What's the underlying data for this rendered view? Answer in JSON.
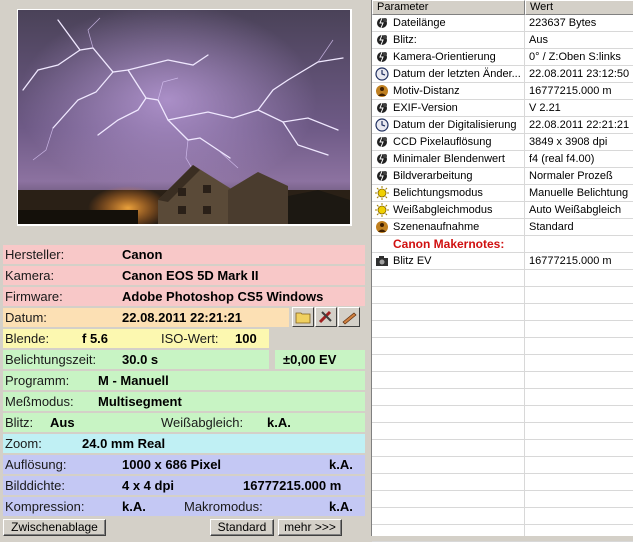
{
  "camera": {
    "hersteller_label": "Hersteller:",
    "hersteller": "Canon",
    "kamera_label": "Kamera:",
    "kamera": "Canon EOS 5D Mark II",
    "firmware_label": "Firmware:",
    "firmware": "Adobe Photoshop CS5 Windows",
    "datum_label": "Datum:",
    "datum": "22.08.2011 22:21:21",
    "blende_label": "Blende:",
    "blende": "f 5.6",
    "iso_label": "ISO-Wert:",
    "iso": "100",
    "belichtungszeit_label": "Belichtungszeit:",
    "belichtungszeit": "30.0 s",
    "ev": "±0,00 EV",
    "programm_label": "Programm:",
    "programm": "M - Manuell",
    "messmodus_label": "Meßmodus:",
    "messmodus": "Multisegment",
    "blitz_label": "Blitz:",
    "blitz": "Aus",
    "weiss_label": "Weißabgleich:",
    "weiss": "k.A.",
    "zoom_label": "Zoom:",
    "zoom": "24.0 mm Real",
    "aufloesung_label": "Auflösung:",
    "aufloesung": "1000 x 686 Pixel",
    "aufloesung_extra": "k.A.",
    "bilddichte_label": "Bilddichte:",
    "bilddichte": "4 x 4 dpi",
    "bilddichte_extra": "16777215.000 m",
    "kompression_label": "Kompression:",
    "kompression": "k.A.",
    "makro_label": "Makromodus:",
    "makro": "k.A."
  },
  "buttons": {
    "zwischenablage": "Zwischenablage",
    "standard": "Standard",
    "mehr": "mehr >>>"
  },
  "table": {
    "col_param": "Parameter",
    "col_wert": "Wert",
    "rows": [
      {
        "icon": "flash-dark-icon",
        "name": "Dateilänge",
        "value": "223637 Bytes"
      },
      {
        "icon": "flash-dark-icon",
        "name": "Blitz:",
        "value": "Aus"
      },
      {
        "icon": "flash-dark-icon",
        "name": "Kamera-Orientierung",
        "value": "0° / Z:Oben S:links"
      },
      {
        "icon": "clock-icon",
        "name": "Datum der letzten Änder...",
        "value": "22.08.2011 23:12:50"
      },
      {
        "icon": "person-icon",
        "name": "Motiv-Distanz",
        "value": "16777215.000 m"
      },
      {
        "icon": "flash-dark-icon",
        "name": "EXIF-Version",
        "value": "V 2.21"
      },
      {
        "icon": "clock-icon",
        "name": "Datum der Digitalisierung",
        "value": "22.08.2011 22:21:21"
      },
      {
        "icon": "flash-dark-icon",
        "name": "CCD Pixelauflösung",
        "value": "3849 x 3908 dpi"
      },
      {
        "icon": "flash-dark-icon",
        "name": "Minimaler Blendenwert",
        "value": "f4 (real f4.00)"
      },
      {
        "icon": "flash-dark-icon",
        "name": "Bildverarbeitung",
        "value": "Normaler Prozeß"
      },
      {
        "icon": "sun-icon",
        "name": "Belichtungsmodus",
        "value": "Manuelle Belichtung"
      },
      {
        "icon": "sun-icon",
        "name": "Weißabgleichmodus",
        "value": "Auto Weißabgleich"
      },
      {
        "icon": "person-icon",
        "name": "Szenenaufnahme",
        "value": "Standard"
      },
      {
        "icon": "",
        "name": "Canon Makernotes:",
        "value": ""
      },
      {
        "icon": "camera-icon",
        "name": "Blitz EV",
        "value": "16777215.000 m"
      }
    ]
  },
  "colors": {
    "pink": "#f8c8c8",
    "orange": "#fce0b4",
    "yellow": "#fcf8b0",
    "green": "#c8f4c4",
    "cyan": "#c0f0f4",
    "blue": "#c4c8f4",
    "makernotes_red": "#d01010"
  }
}
